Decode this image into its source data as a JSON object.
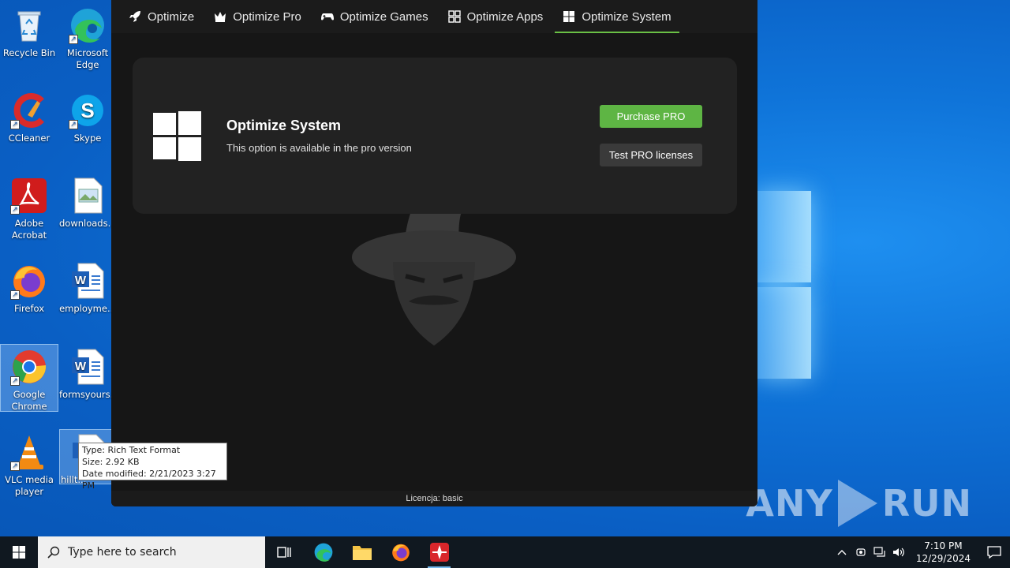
{
  "desktop": {
    "icons": [
      {
        "label": "Recycle Bin"
      },
      {
        "label": "Microsoft Edge"
      },
      {
        "label": "CCleaner"
      },
      {
        "label": "Skype"
      },
      {
        "label": "Adobe Acrobat"
      },
      {
        "label": "downloads..."
      },
      {
        "label": "Firefox"
      },
      {
        "label": "employme..."
      },
      {
        "label": "Google Chrome"
      },
      {
        "label": "formsyours..."
      },
      {
        "label": "VLC media player"
      },
      {
        "label": "hillt..."
      }
    ],
    "watermark": {
      "left": "ANY",
      "right": "RUN"
    }
  },
  "tooltip": {
    "type": "Type: Rich Text Format",
    "size": "Size: 2.92 KB",
    "modified": "Date modified: 2/21/2023 3:27 PM"
  },
  "app": {
    "tabs": [
      {
        "label": "Optimize",
        "icon": "rocket-icon"
      },
      {
        "label": "Optimize Pro",
        "icon": "crown-icon"
      },
      {
        "label": "Optimize Games",
        "icon": "gamepad-icon"
      },
      {
        "label": "Optimize Apps",
        "icon": "apps-grid-icon"
      },
      {
        "label": "Optimize System",
        "icon": "windows-icon",
        "active": true
      }
    ],
    "card": {
      "title": "Optimize System",
      "subtitle": "This option is available in the pro version",
      "purchase_label": "Purchase PRO",
      "test_label": "Test PRO licenses"
    },
    "status": "Licencja: basic",
    "accent": "#5eb544"
  },
  "taskbar": {
    "search_placeholder": "Type here to search",
    "time": "7:10 PM",
    "date": "12/29/2024"
  }
}
